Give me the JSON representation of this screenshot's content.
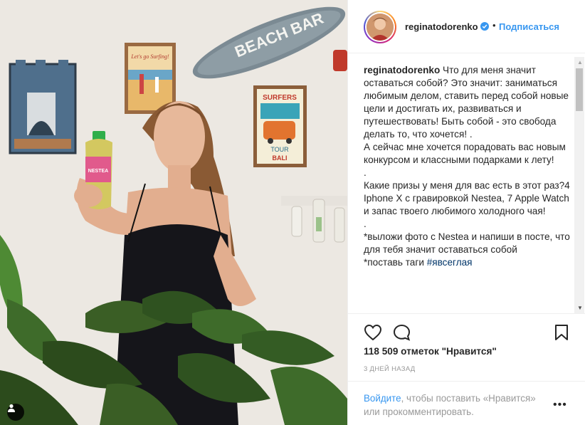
{
  "photo": {
    "alt_sign_text": "BEACH BAR",
    "poster1_text": "Let's go Surfing!",
    "poster2_top": "SURFERS",
    "poster2_mid": "TOUR",
    "poster2_bottom": "BALI",
    "bottle_brand": "NESTEA"
  },
  "header": {
    "username": "reginatodorenko",
    "separator": "•",
    "follow_label": "Подписаться"
  },
  "caption": {
    "username": "reginatodorenko",
    "text": "Что для меня значит оставаться собой? Это значит: заниматься любимым делом, ставить перед собой новые цели и достигать их, развиваться и путешествовать! Быть собой - это свобода делать то, что хочется! .\nА сейчас мне хочется порадовать вас новым конкурсом и классными подарками к лету!\n.\nКакие призы у меня для вас есть в этот раз?4 Iphone X с гравировкой Nestea, 7 Apple Watch и запас твоего любимого холодного чая!\n.\n*выложи фото с Nestea и напиши в посте, что для тебя значит оставаться собой\n*поставь таги ",
    "hashtag": "#явсеглая"
  },
  "stats": {
    "likes": "118 509 отметок \"Нравится\"",
    "time": "3 ДНЕЙ НАЗАД"
  },
  "footer": {
    "login_link": "Войдите",
    "login_rest": ", чтобы поставить «Нравится» или прокомментировать.",
    "more": "•••"
  },
  "icons": [
    "heart-icon",
    "comment-icon",
    "bookmark-icon",
    "user-tag-icon",
    "verified-icon"
  ],
  "colors": {
    "accent": "#3897f0",
    "text": "#262626",
    "muted": "#999999",
    "hashtag": "#003569"
  }
}
